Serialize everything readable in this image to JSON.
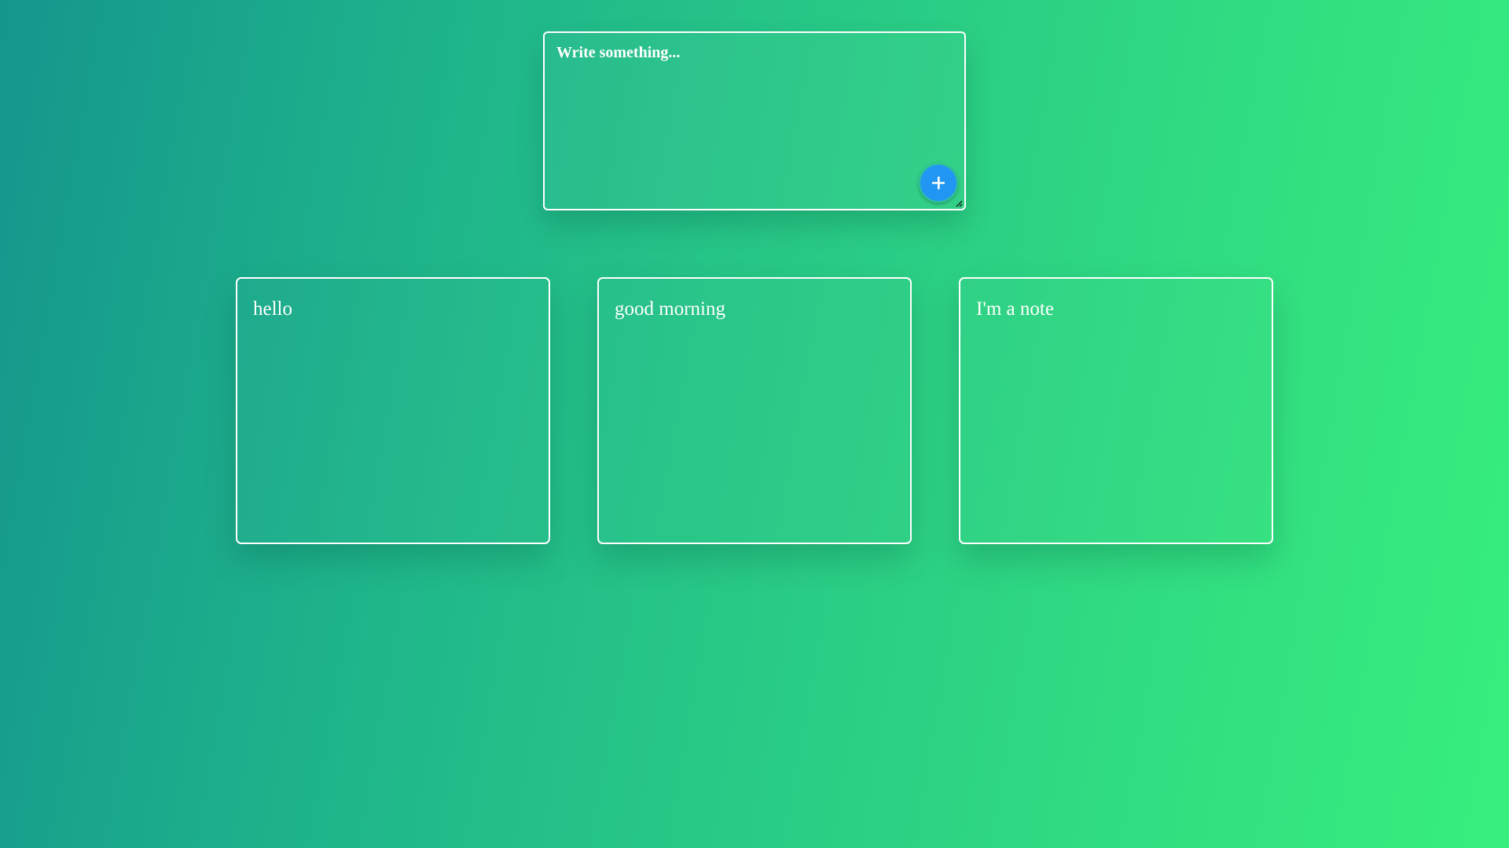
{
  "composer": {
    "placeholder": "Write something...",
    "value": "",
    "add_icon": "plus-icon",
    "button_color": "#2196f3"
  },
  "notes": [
    {
      "text": "hello"
    },
    {
      "text": "good morning"
    },
    {
      "text": "I'm a note"
    }
  ],
  "background": {
    "gradient_start": "#15968d",
    "gradient_end": "#38ef7d"
  }
}
